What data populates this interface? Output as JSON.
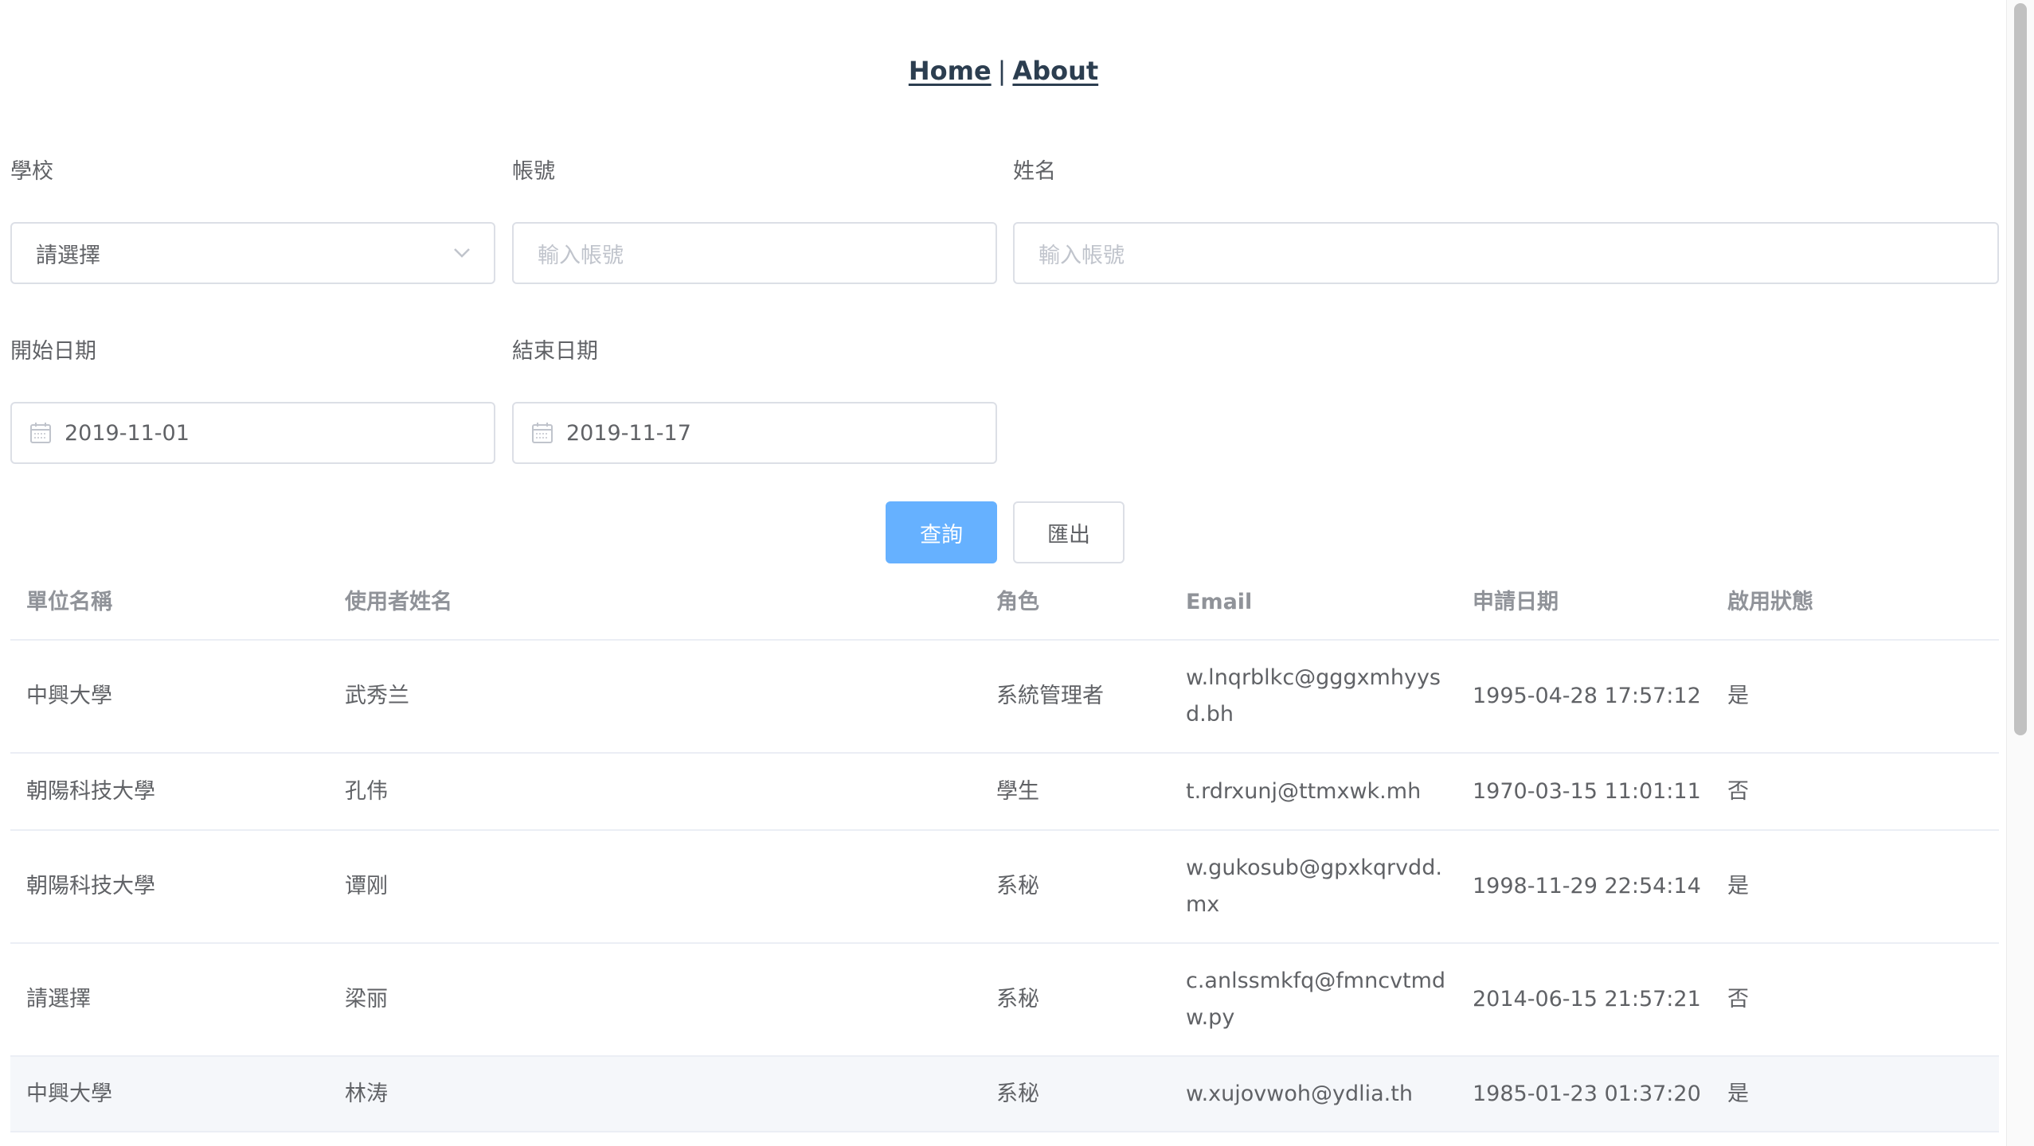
{
  "nav": {
    "home": "Home",
    "separator": "|",
    "about": "About"
  },
  "form": {
    "school_label": "學校",
    "school_value": "請選擇",
    "account_label": "帳號",
    "account_placeholder": "輸入帳號",
    "name_label": "姓名",
    "name_placeholder": "輸入帳號",
    "start_label": "開始日期",
    "start_value": "2019-11-01",
    "end_label": "結束日期",
    "end_value": "2019-11-17",
    "query_button": "查詢",
    "export_button": "匯出"
  },
  "table": {
    "headers": [
      "單位名稱",
      "使用者姓名",
      "角色",
      "Email",
      "申請日期",
      "啟用狀態"
    ],
    "rows": [
      [
        "中興大學",
        "武秀兰",
        "系統管理者",
        "w.lnqrblkc@gggxmhyysd.bh",
        "1995-04-28 17:57:12",
        "是"
      ],
      [
        "朝陽科技大學",
        "孔伟",
        "學生",
        "t.rdrxunj@ttmxwk.mh",
        "1970-03-15 11:01:11",
        "否"
      ],
      [
        "朝陽科技大學",
        "谭刚",
        "系秘",
        "w.gukosub@gpxkqrvdd.mx",
        "1998-11-29 22:54:14",
        "是"
      ],
      [
        "請選擇",
        "梁丽",
        "系秘",
        "c.anlssmkfq@fmncvtmdw.py",
        "2014-06-15 21:57:21",
        "否"
      ],
      [
        "中興大學",
        "林涛",
        "系秘",
        "w.xujovwoh@ydlia.th",
        "1985-01-23 01:37:20",
        "是"
      ]
    ]
  },
  "colors": {
    "primary": "#66b1ff",
    "border": "#dcdfe6",
    "text": "#606266",
    "header_text": "#909399",
    "nav_text": "#2c3e50"
  }
}
